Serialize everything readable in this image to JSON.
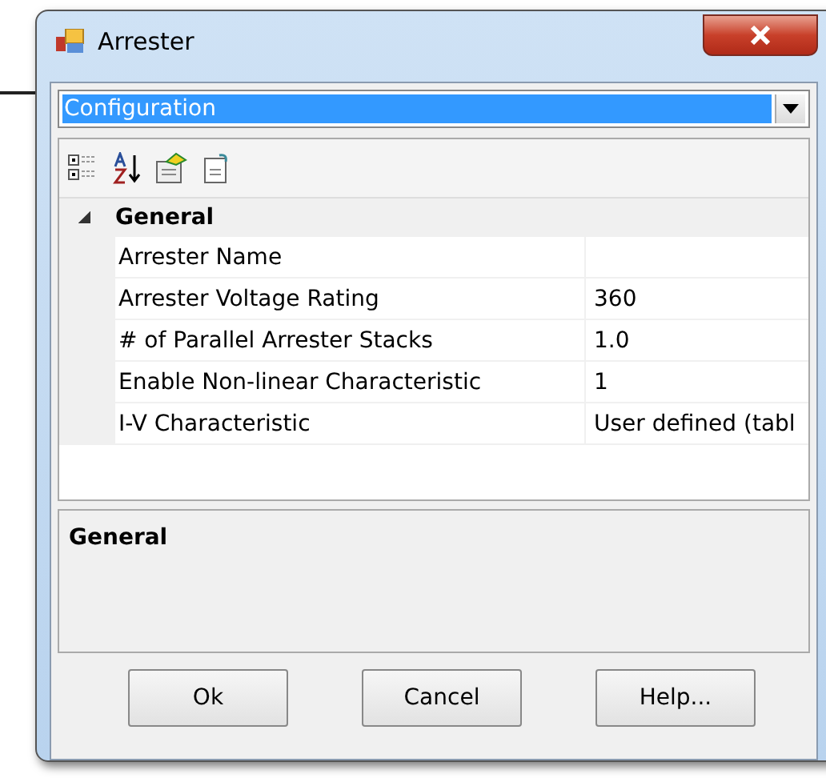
{
  "window": {
    "title": "Arrester"
  },
  "selector": {
    "value": "Configuration"
  },
  "grid": {
    "categories": [
      {
        "name": "General",
        "expanded": true,
        "properties": [
          {
            "name": "Arrester Name"
          },
          {
            "name": "Arrester Voltage Rating",
            "value": "360"
          },
          {
            "name": "# of Parallel Arrester Stacks",
            "value": "1.0"
          },
          {
            "name": "Enable Non-linear Characteristic",
            "value": "1"
          },
          {
            "name": "I-V Characteristic",
            "value": "User defined (tabl"
          }
        ]
      }
    ]
  },
  "description": {
    "title": "General"
  },
  "buttons": [
    "Ok",
    "Cancel",
    "Help..."
  ]
}
